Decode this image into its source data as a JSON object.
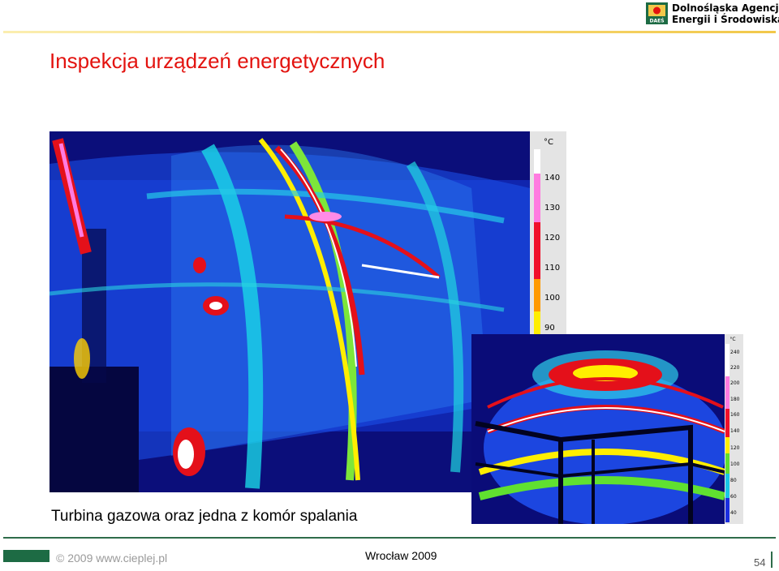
{
  "header": {
    "org_line1": "Dolnośląska Agencja",
    "org_line2": "Energii i Środowiska",
    "logo_abbrev": "DAEŚ",
    "accent": "#e3130f",
    "logo_green": "#1d6b44"
  },
  "title": "Inspekcja urządzeń energetycznych",
  "thermal_main": {
    "unit": "°C",
    "scale_labels": [
      "140",
      "130",
      "120",
      "110",
      "100",
      "90"
    ]
  },
  "thermal_inset": {
    "unit": "°C",
    "scale_labels": [
      "240",
      "220",
      "200",
      "180",
      "160",
      "140",
      "120",
      "100",
      "80",
      "60",
      "40"
    ]
  },
  "caption": "Turbina gazowa oraz jedna z komór spalania",
  "footer": {
    "copyright": "© 2009 www.cieplej.pl",
    "place_date": "Wrocław 2009",
    "page_number": "54"
  }
}
